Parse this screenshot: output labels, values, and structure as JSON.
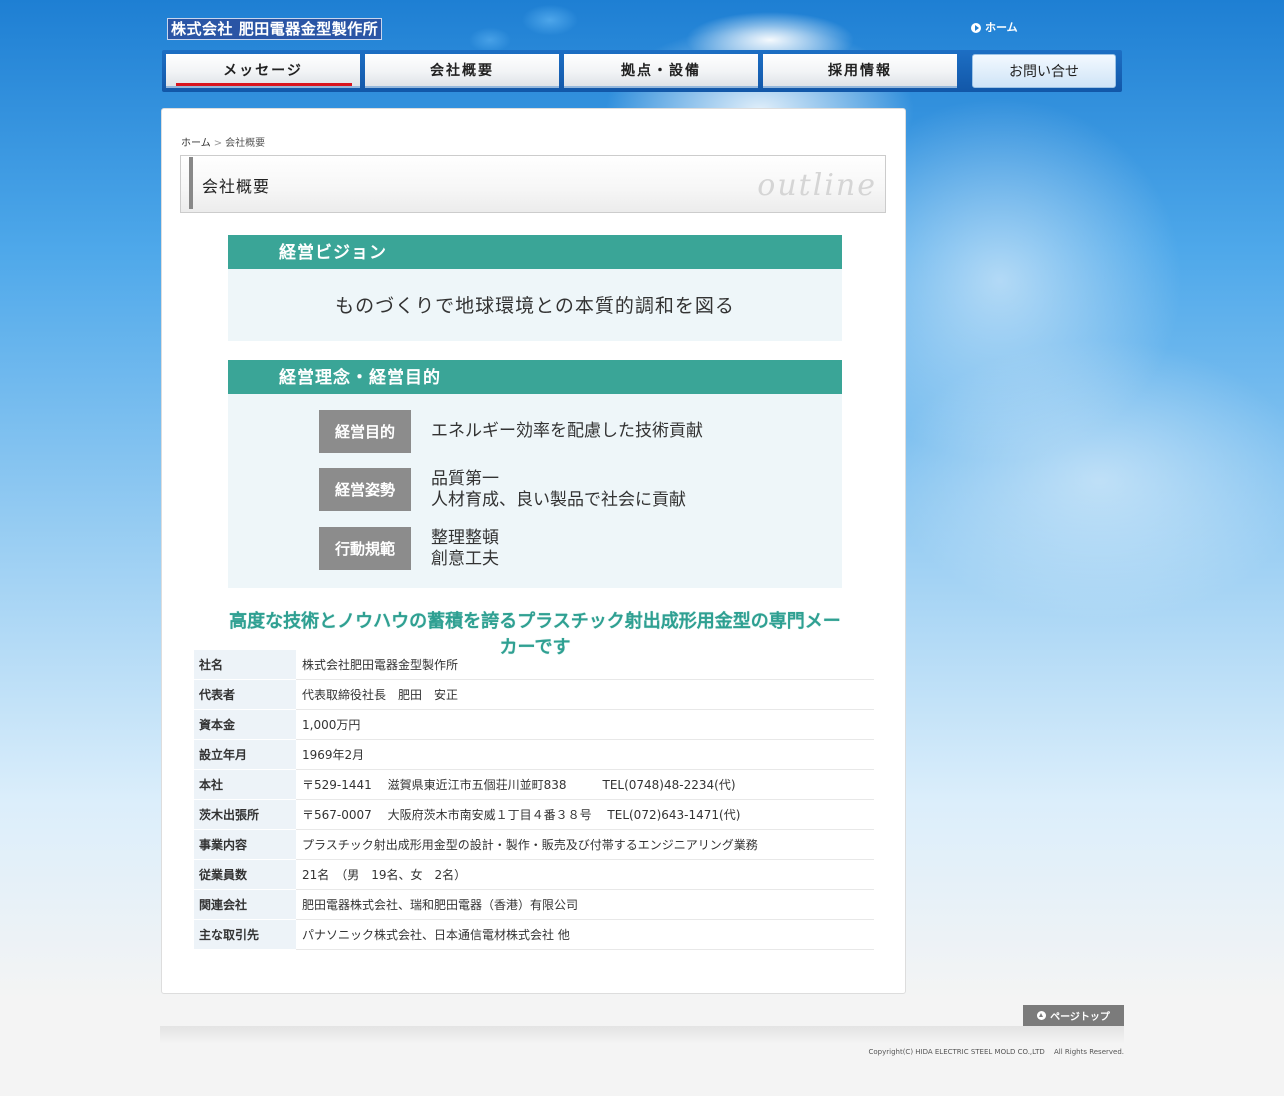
{
  "header": {
    "logo_text": "株式会社 肥田電器金型製作所",
    "home_link": "ホーム"
  },
  "nav": {
    "items": [
      "メッセージ",
      "会社概要",
      "拠点・設備",
      "採用情報"
    ],
    "active_index": 0,
    "contact": "お問い合せ"
  },
  "breadcrumb": {
    "home": "ホーム",
    "separator": ">",
    "current": "会社概要"
  },
  "page_title": {
    "ja": "会社概要",
    "en": "outline"
  },
  "vision": {
    "heading": "経営ビジョン",
    "statement": "ものづくりで地球環境との本質的調和を図る"
  },
  "philosophy": {
    "heading": "経営理念・経営目的",
    "rows": [
      {
        "label": "経営目的",
        "line1": "エネルギー効率を配慮した技術貢献",
        "line2": ""
      },
      {
        "label": "経営姿勢",
        "line1": "品質第一",
        "line2": "人材育成、良い製品で社会に貢献"
      },
      {
        "label": "行動規範",
        "line1": "整理整頓",
        "line2": "創意工夫"
      }
    ]
  },
  "slogan": "高度な技術とノウハウの蓄積を誇るプラスチック射出成形用金型の専門メーカーです",
  "company_info": [
    {
      "key": "社名",
      "value": "株式会社肥田電器金型製作所"
    },
    {
      "key": "代表者",
      "value": "代表取締役社長　肥田　安正"
    },
    {
      "key": "資本金",
      "value": "1,000万円"
    },
    {
      "key": "設立年月",
      "value": "1969年2月"
    },
    {
      "key": "本社",
      "value": "〒529-1441　 滋賀県東近江市五個荘川並町838　　　TEL(0748)48-2234(代)"
    },
    {
      "key": "茨木出張所",
      "value": "〒567-0007　 大阪府茨木市南安威１丁目４番３８号　 TEL(072)643-1471(代)"
    },
    {
      "key": "事業内容",
      "value": "プラスチック射出成形用金型の設計・製作・販売及び付帯するエンジニアリング業務"
    },
    {
      "key": "従業員数",
      "value": "21名　（男　19名、女　2名）"
    },
    {
      "key": "関連会社",
      "value": "肥田電器株式会社、瑞和肥田電器（香港）有限公司"
    },
    {
      "key": "主な取引先",
      "value": "パナソニック株式会社、日本通信電材株式会社 他"
    }
  ],
  "footer": {
    "page_top": "ページトップ",
    "copyright": "Copyright(C) HIDA ELECTRIC STEEL MOLD CO.,LTD　 All Rights Reserved."
  }
}
